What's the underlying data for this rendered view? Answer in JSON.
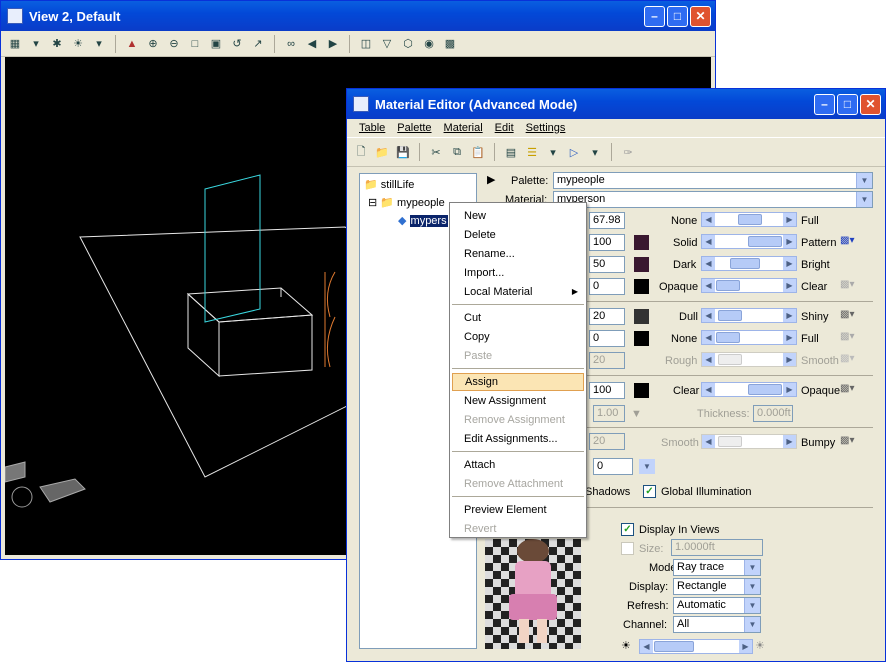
{
  "view": {
    "title": "View 2, Default",
    "toolbar_icons": [
      "view-attributes-icon",
      "dropdown-icon",
      "display-style-icon",
      "lighting-icon",
      "dropdown-icon",
      "update-icon",
      "zoom-in-icon",
      "zoom-out-icon",
      "window-area-icon",
      "fit-view-icon",
      "rotate-icon",
      "pan-icon",
      "walk-icon",
      "previous-view-icon",
      "next-view-icon",
      "copy-view-icon",
      "clip-volume-icon",
      "view-display-icon",
      "camera-icon",
      "render-icon"
    ]
  },
  "editor": {
    "title": "Material Editor (Advanced Mode)",
    "menu": [
      "Table",
      "Palette",
      "Material",
      "Edit",
      "Settings"
    ],
    "tree": {
      "root": "stillLife",
      "palette": "mypeople",
      "material": "mypers"
    },
    "palette_label": "Palette:",
    "palette_value": "mypeople",
    "material_label": "Material:",
    "material_value": "myperson",
    "rows": [
      {
        "value": "67.98",
        "left": "None",
        "right": "Full"
      },
      {
        "value": "100",
        "left": "Solid",
        "right": "Pattern"
      },
      {
        "value": "50",
        "left": "Dark",
        "right": "Bright"
      },
      {
        "value": "0",
        "left": "Opaque",
        "right": "Clear"
      },
      {
        "value": "20",
        "left": "Dull",
        "right": "Shiny"
      },
      {
        "value": "0",
        "left": "None",
        "right": "Full"
      },
      {
        "value": "20",
        "left": "Rough",
        "right": "Smooth"
      },
      {
        "value": "100",
        "left": "Clear",
        "right": "Opaque"
      },
      {
        "value": "20",
        "left": "Smooth",
        "right": "Bumpy"
      }
    ],
    "refraction_value": "1.00",
    "thickness_label": "Thickness:",
    "thickness_value": "0.000ft",
    "glow_value": "0",
    "shadows_label": "Shadows",
    "gi_label": "Global Illumination",
    "display_in_views": "Display In Views",
    "size_label": "Size:",
    "size_value": "1.0000ft",
    "mode_label": "Mode:",
    "mode_value": "Ray trace",
    "display_label": "Display:",
    "display_value": "Rectangle",
    "refresh_label": "Refresh:",
    "refresh_value": "Automatic",
    "channel_label": "Channel:",
    "channel_value": "All"
  },
  "context_menu": {
    "items": [
      {
        "label": "New",
        "enabled": true
      },
      {
        "label": "Delete",
        "enabled": true
      },
      {
        "label": "Rename...",
        "enabled": true
      },
      {
        "label": "Import...",
        "enabled": true
      },
      {
        "label": "Local Material",
        "enabled": true,
        "submenu": true
      },
      {
        "label": "Cut",
        "enabled": true
      },
      {
        "label": "Copy",
        "enabled": true
      },
      {
        "label": "Paste",
        "enabled": false
      },
      {
        "label": "Assign",
        "enabled": true,
        "highlighted": true
      },
      {
        "label": "New Assignment",
        "enabled": true
      },
      {
        "label": "Remove Assignment",
        "enabled": false
      },
      {
        "label": "Edit Assignments...",
        "enabled": true
      },
      {
        "label": "Attach",
        "enabled": true
      },
      {
        "label": "Remove Attachment",
        "enabled": false
      },
      {
        "label": "Preview Element",
        "enabled": true
      },
      {
        "label": "Revert",
        "enabled": false
      }
    ]
  }
}
